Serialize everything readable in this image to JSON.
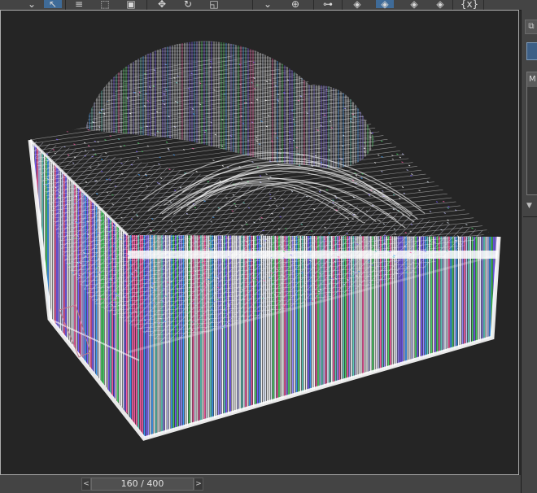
{
  "toolbar": {
    "items": [
      {
        "name": "select-filter-dropdown",
        "glyph": "⌄",
        "active": false
      },
      {
        "name": "select-object-tool",
        "glyph": "↖",
        "active": true
      },
      {
        "name": "select-by-name-tool",
        "glyph": "≡",
        "active": false
      },
      {
        "name": "rectangular-selection-tool",
        "glyph": "⬚",
        "active": false
      },
      {
        "name": "window-crossing-toggle",
        "glyph": "▣",
        "active": false
      },
      {
        "name": "select-and-move-tool",
        "glyph": "✥",
        "active": false
      },
      {
        "name": "select-and-rotate-tool",
        "glyph": "↻",
        "active": false
      },
      {
        "name": "select-and-scale-tool",
        "glyph": "◱",
        "active": false
      },
      {
        "name": "reference-coordinate-dropdown",
        "glyph": "⌄",
        "active": false
      },
      {
        "name": "use-pivot-center-tool",
        "glyph": "⊕",
        "active": false
      },
      {
        "name": "select-and-link-tool",
        "glyph": "⊶",
        "active": false
      },
      {
        "name": "snap-toggle",
        "glyph": "◈",
        "active": false
      },
      {
        "name": "angle-snap-toggle",
        "glyph": "◈",
        "active": true
      },
      {
        "name": "percent-snap-toggle",
        "glyph": "◈",
        "active": false
      },
      {
        "name": "spinner-snap-toggle",
        "glyph": "◈",
        "active": false
      },
      {
        "name": "named-selection-sets-button",
        "glyph": "{x}",
        "active": false
      }
    ]
  },
  "command_panel": {
    "list_header": "M"
  },
  "timeline": {
    "frame_label": "160 / 400",
    "current_frame": 160,
    "total_frames": 400,
    "prev_glyph": "<",
    "next_glyph": ">"
  },
  "colors": {
    "viewport_bg": "#252525",
    "panel_bg": "#444444",
    "active_blue": "#3f6b98",
    "wireframe": "#ffffff"
  }
}
